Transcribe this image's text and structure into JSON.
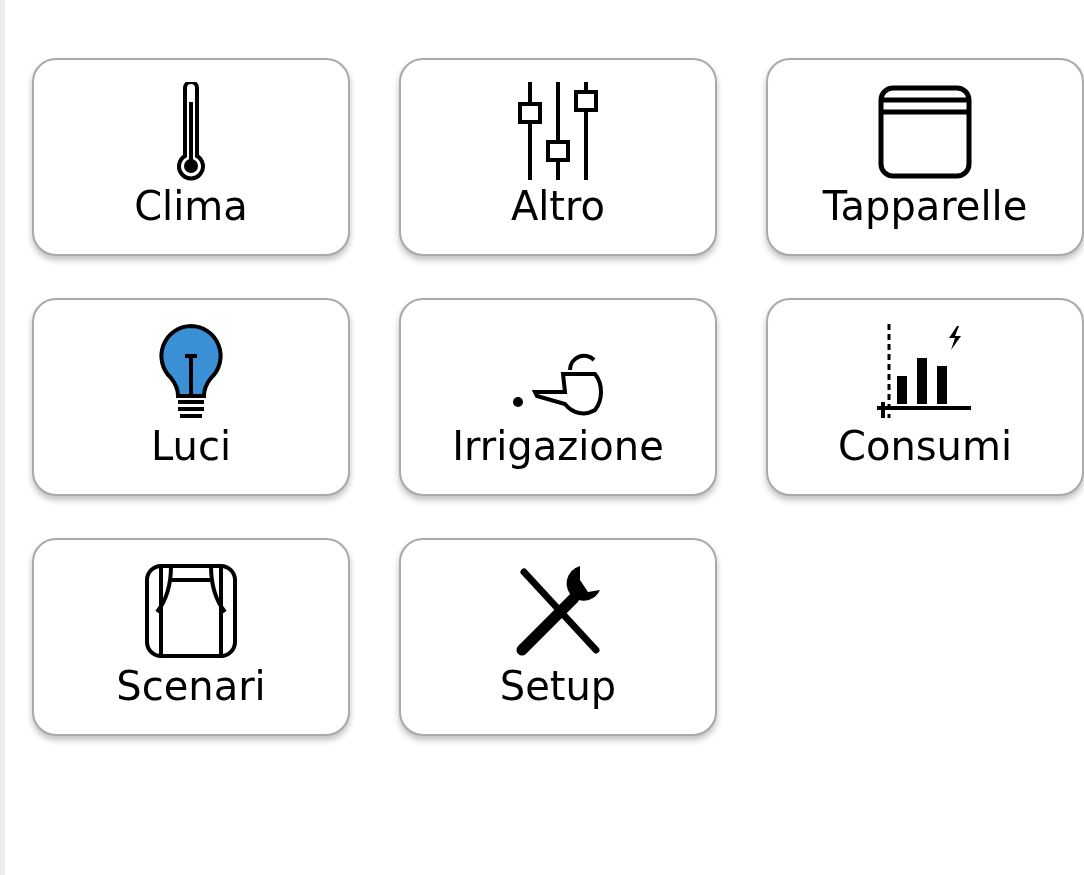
{
  "tiles": [
    {
      "label": "Clima",
      "kind": "thermometer"
    },
    {
      "label": "Altro",
      "kind": "sliders"
    },
    {
      "label": "Tapparelle",
      "kind": "blind"
    },
    {
      "label": "Luci",
      "kind": "bulb",
      "on": true
    },
    {
      "label": "Irrigazione",
      "kind": "watering-can"
    },
    {
      "label": "Consumi",
      "kind": "chart"
    },
    {
      "label": "Scenari",
      "kind": "curtain"
    },
    {
      "label": "Setup",
      "kind": "tools"
    }
  ]
}
